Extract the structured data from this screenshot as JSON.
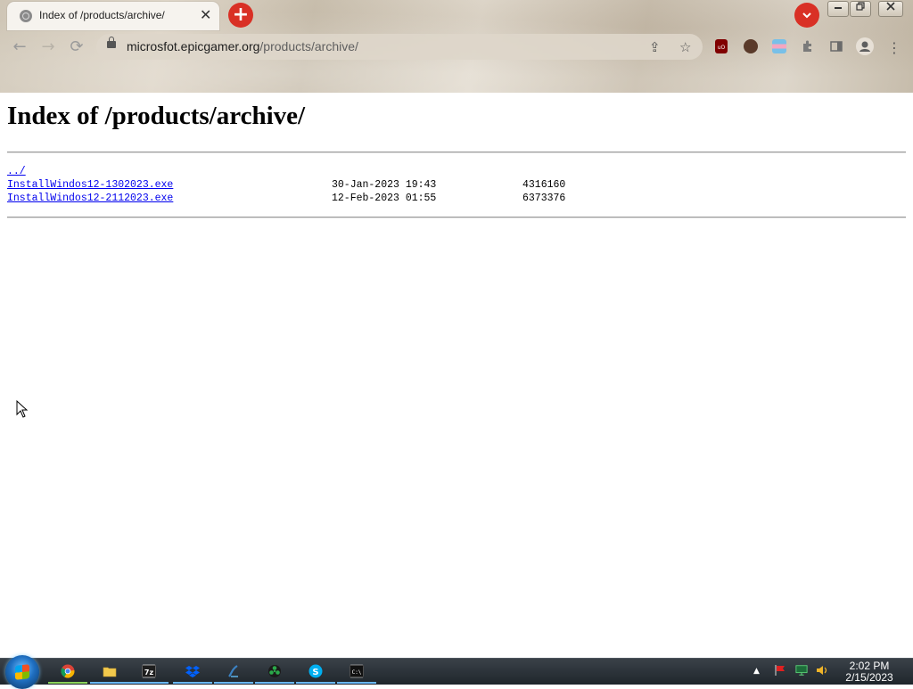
{
  "browser": {
    "tab_title": "Index of /products/archive/",
    "tab_close": "✕",
    "new_tab_label": "+",
    "tab_search_label": "⌄",
    "window_minimize": "—",
    "window_restore": "❐",
    "window_close": "✕",
    "url_host": "microsfot.epicgamer.org",
    "url_path": "/products/archive/",
    "back_glyph": "←",
    "forward_glyph": "→",
    "reload_glyph": "⟳",
    "share_glyph": "⇪",
    "star_glyph": "☆",
    "menu_glyph": "⋮",
    "extensions": [
      {
        "name": "ublock-origin-icon",
        "label": "uO",
        "color": "#800000"
      },
      {
        "name": "avatar-extension-icon",
        "label": "",
        "color": "#5a3a2a"
      },
      {
        "name": "flag-extension-icon",
        "label": "",
        "color": "#78c0e8"
      },
      {
        "name": "puzzle-extensions-icon",
        "label": "",
        "color": "#7a7a7a"
      },
      {
        "name": "side-panel-icon",
        "label": "",
        "color": "#7a7a7a"
      },
      {
        "name": "profile-icon",
        "label": "",
        "color": "#7a7a7a"
      }
    ]
  },
  "page": {
    "heading": "Index of /products/archive/",
    "parent_link": "../",
    "files": [
      {
        "name": "InstallWindos12-1302023.exe",
        "date": "30-Jan-2023 19:43",
        "size": "4316160"
      },
      {
        "name": "InstallWindos12-2112023.exe",
        "date": "12-Feb-2023 01:55",
        "size": "6373376"
      }
    ]
  },
  "taskbar": {
    "apps": [
      {
        "name": "chrome-taskbar-icon",
        "color": "#e0463a"
      },
      {
        "name": "file-explorer-taskbar-icon",
        "color": "#f2c94c"
      },
      {
        "name": "7zip-taskbar-icon",
        "color": "#202020"
      },
      {
        "name": "dropbox-taskbar-icon",
        "color": "#0061fe"
      },
      {
        "name": "python-taskbar-icon",
        "color": "#3b82c4"
      },
      {
        "name": "greenshot-taskbar-icon",
        "color": "#2aa84a"
      },
      {
        "name": "skype-taskbar-icon",
        "color": "#00aff0"
      },
      {
        "name": "cmd-taskbar-icon",
        "color": "#111111"
      }
    ],
    "seven_zip_label": "7z",
    "cmd_label": "C:\\",
    "clock_time": "2:02 PM",
    "clock_date": "2/15/2023"
  }
}
